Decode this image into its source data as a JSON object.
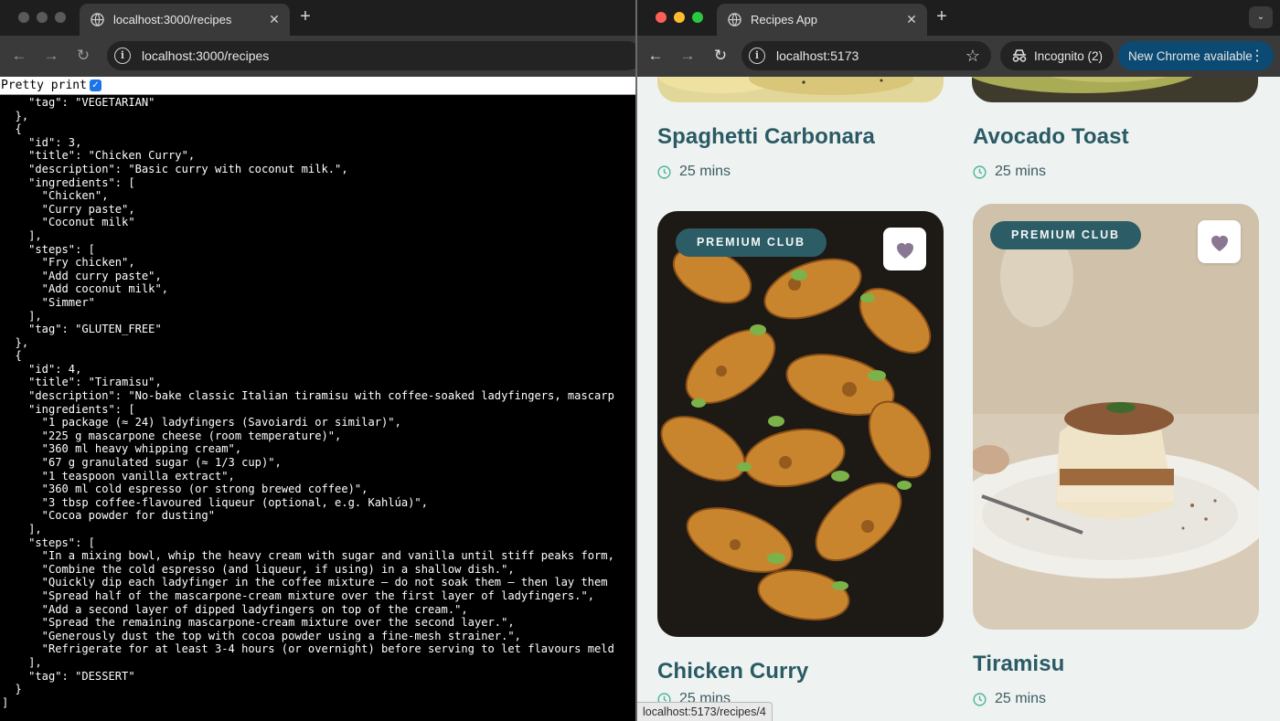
{
  "left_window": {
    "tab": {
      "title": "localhost:3000/recipes",
      "close": "✕"
    },
    "new_tab": "+",
    "nav": {
      "back": "←",
      "forward": "→",
      "reload": "↻"
    },
    "address": "localhost:3000/recipes",
    "pretty_print_label": "Pretty print",
    "pretty_print_checked": true,
    "json_lines": [
      "    \"tag\": \"VEGETARIAN\"",
      "  },",
      "  {",
      "    \"id\": 3,",
      "    \"title\": \"Chicken Curry\",",
      "    \"description\": \"Basic curry with coconut milk.\",",
      "    \"ingredients\": [",
      "      \"Chicken\",",
      "      \"Curry paste\",",
      "      \"Coconut milk\"",
      "    ],",
      "    \"steps\": [",
      "      \"Fry chicken\",",
      "      \"Add curry paste\",",
      "      \"Add coconut milk\",",
      "      \"Simmer\"",
      "    ],",
      "    \"tag\": \"GLUTEN_FREE\"",
      "  },",
      "  {",
      "    \"id\": 4,",
      "    \"title\": \"Tiramisu\",",
      "    \"description\": \"No-bake classic Italian tiramisu with coffee-soaked ladyfingers, mascarp",
      "    \"ingredients\": [",
      "      \"1 package (≈ 24) ladyfingers (Savoiardi or similar)\",",
      "      \"225 g mascarpone cheese (room temperature)\",",
      "      \"360 ml heavy whipping cream\",",
      "      \"67 g granulated sugar (≈ 1/3 cup)\",",
      "      \"1 teaspoon vanilla extract\",",
      "      \"360 ml cold espresso (or strong brewed coffee)\",",
      "      \"3 tbsp coffee-flavoured liqueur (optional, e.g. Kahlúa)\",",
      "      \"Cocoa powder for dusting\"",
      "    ],",
      "    \"steps\": [",
      "      \"In a mixing bowl, whip the heavy cream with sugar and vanilla until stiff peaks form,",
      "      \"Combine the cold espresso (and liqueur, if using) in a shallow dish.\",",
      "      \"Quickly dip each ladyfinger in the coffee mixture — do not soak them — then lay them",
      "      \"Spread half of the mascarpone-cream mixture over the first layer of ladyfingers.\",",
      "      \"Add a second layer of dipped ladyfingers on top of the cream.\",",
      "      \"Spread the remaining mascarpone-cream mixture over the second layer.\",",
      "      \"Generously dust the top with cocoa powder using a fine-mesh strainer.\",",
      "      \"Refrigerate for at least 3-4 hours (or overnight) before serving to let flavours meld",
      "    ],",
      "    \"tag\": \"DESSERT\"",
      "  }",
      "]"
    ]
  },
  "right_window": {
    "tab": {
      "title": "Recipes App",
      "close": "✕"
    },
    "new_tab": "+",
    "tab_search": "⌄",
    "nav": {
      "back": "←",
      "forward": "→",
      "reload": "↻"
    },
    "address": "localhost:5173",
    "bookmark": "☆",
    "incognito_label": "Incognito (2)",
    "update_label": "New Chrome available",
    "update_menu": "⋮",
    "status_url": "localhost:5173/recipes/4",
    "colors": {
      "title": "#2a5a64",
      "badge": "#2c5d66",
      "clock": "#4fb39a",
      "heart": "#8a7893",
      "update_pill": "#0b4a73"
    },
    "top_cards": [
      {
        "title": "Spaghetti Carbonara",
        "time": "25 mins"
      },
      {
        "title": "Avocado Toast",
        "time": "25 mins"
      }
    ],
    "cards": [
      {
        "badge": "PREMIUM CLUB",
        "title": "Chicken Curry",
        "time": "25 mins",
        "image": "roasted-chicken-drumsticks-image",
        "favorite_icon": "heart-icon"
      },
      {
        "badge": "PREMIUM CLUB",
        "title": "Tiramisu",
        "time": "25 mins",
        "image": "tiramisu-slice-image",
        "favorite_icon": "heart-icon"
      }
    ]
  }
}
